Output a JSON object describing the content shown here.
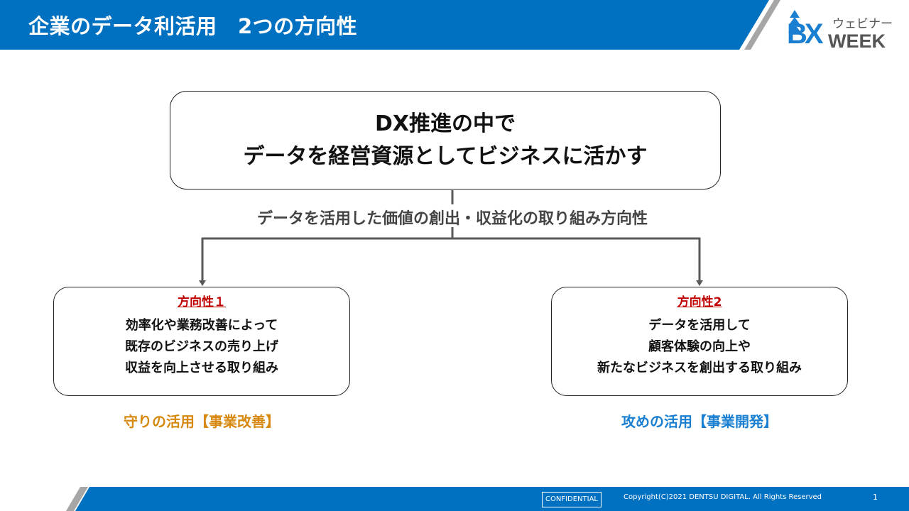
{
  "header": {
    "title": "企業のデータ利活用　2つの方向性",
    "logo": {
      "mark": "BX",
      "subtitle": "ウェビナー",
      "week": "WEEK",
      "icon": "tree-arrow-icon"
    }
  },
  "colors": {
    "brand_blue": "#0070c0",
    "stripe_gray": "#a6a6a6",
    "direction_label_red": "#c00000",
    "defense_orange": "#d6880f",
    "offense_blue": "#1a7fd0",
    "connector_gray": "#595959"
  },
  "diagram": {
    "top_box": {
      "lines": [
        "DX推進の中で",
        "データを経営資源としてビジネスに活かす"
      ]
    },
    "connector_label": "データを活用した価値の創出・収益化の取り組み方向性",
    "directions": [
      {
        "title": "方向性１",
        "lines": [
          "効率化や業務改善によって",
          "既存のビジネスの売り上げ",
          "収益を向上させる取り組み"
        ],
        "caption": "守りの活用【事業改善】"
      },
      {
        "title": "方向性2",
        "lines": [
          "データを活用して",
          "顧客体験の向上や",
          "新たなビジネスを創出する取り組み"
        ],
        "caption": "攻めの活用【事業開発】"
      }
    ]
  },
  "footer": {
    "confidential": "CONFIDENTIAL",
    "copyright": "Copyright(C)2021 DENTSU DIGITAL. All Rights Reserved",
    "page_number": "1"
  }
}
